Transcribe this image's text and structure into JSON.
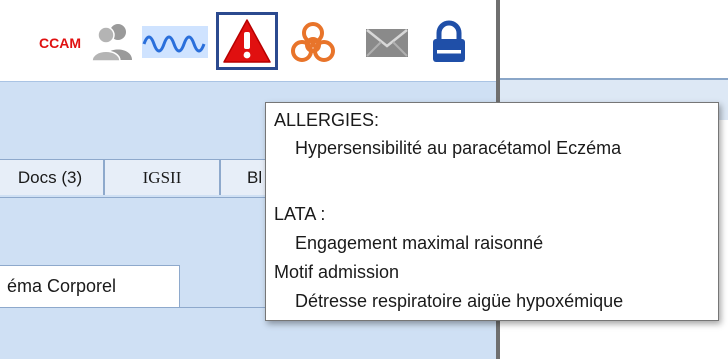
{
  "toolbar": {
    "ccam_label": "CCAM",
    "icons": [
      "users-icon",
      "vital-signs-wave-icon",
      "warning-triangle-icon",
      "biohazard-icon",
      "mail-icon",
      "lock-icon"
    ],
    "colors": {
      "ccam": "#e01010",
      "alert": "#e01010",
      "alert_border": "#2b4a8f",
      "biohazard": "#e8742a",
      "lock": "#1f4fa8",
      "wave": "#2a6fdb"
    }
  },
  "tabs": [
    {
      "label": "Docs (3)"
    },
    {
      "label": "IGSII"
    },
    {
      "label": "Bl"
    }
  ],
  "lower_tab": {
    "label": "éma Corporel"
  },
  "tooltip": {
    "allergies_heading": "ALLERGIES:",
    "allergies_value": "Hypersensibilité au paracétamol Eczéma",
    "lata_heading": "LATA :",
    "lata_value": "Engagement maximal raisonné",
    "motif_heading": "Motif admission",
    "motif_value": "Détresse respiratoire aigüe hypoxémique"
  }
}
